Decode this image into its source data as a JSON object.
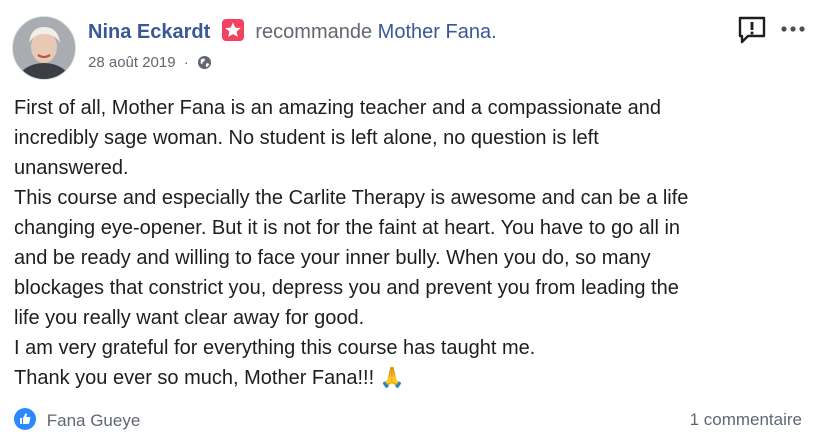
{
  "post": {
    "author": "Nina Eckardt",
    "action_text": "recommande",
    "page_name": "Mother Fana",
    "page_suffix": ".",
    "date": "28 août 2019",
    "meta_separator": "·",
    "body_lines": [
      "First of all, Mother Fana is an amazing teacher and a compassionate and",
      "incredibly sage woman. No student is left alone, no question is left",
      "unanswered.",
      "This course and especially the Carlite Therapy is awesome and can be a life",
      "changing eye-opener. But it is not for the faint at heart. You have to go all in",
      "and be ready and willing to face your inner bully. When you do, so many",
      "blockages that constrict you, depress you and prevent you from leading the",
      "life you really want clear away for good.",
      "I am very grateful for everything this course has taught me.",
      "Thank you ever so much, Mother Fana!!! 🙏"
    ]
  },
  "footer": {
    "reactor_name": "Fana Gueye",
    "comments_label": "1 commentaire"
  },
  "icons": {
    "recommendation_badge": "recommend-badge-icon",
    "privacy": "globe-icon",
    "report": "report-icon",
    "more": "more-options-icon",
    "reaction": "like-icon"
  },
  "colors": {
    "link_blue": "#385898",
    "meta_gray": "#606770",
    "badge_pink": "#f3425f",
    "like_blue": "#2d88ff"
  }
}
